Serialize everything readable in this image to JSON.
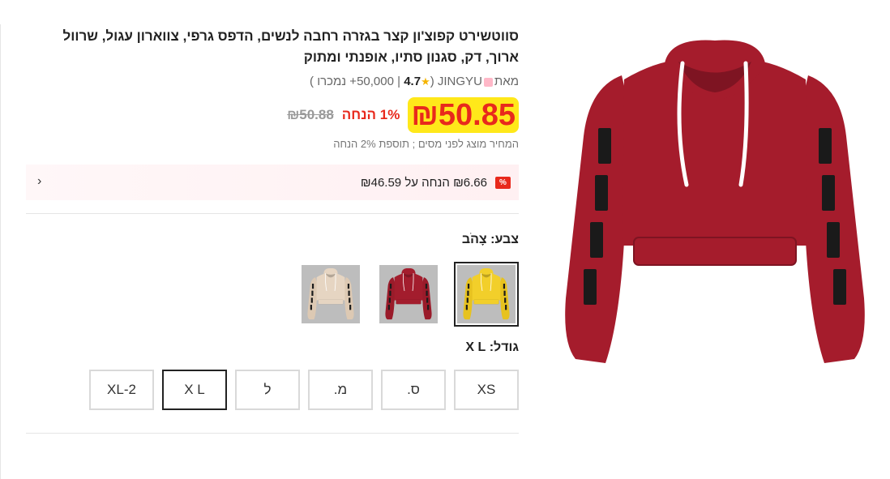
{
  "product": {
    "title": "סווטשירט קפוצ'ון קצר בגזרה רחבה לנשים, הדפס גרפי, צווארון עגול, שרוול ארוך, דק, סגנון סתיו, אופנתי ומתוק",
    "by_label": "מאת",
    "store": "JINGYU",
    "sales_open": "(",
    "sales": "50,000",
    "sales_suffix": "+",
    "rating": "4.7",
    "sold_label": "נמכרו )",
    "separator": "|"
  },
  "pricing": {
    "price": "₪50.85",
    "discount": "1% הנחה",
    "old_price": "₪50.88",
    "tax_note": "המחיר מוצג לפני מסים ; תוספת 2% הנחה"
  },
  "promo": {
    "badge": "%",
    "text": "₪6.66 הנחה על ₪46.59",
    "chevron": "‹"
  },
  "color": {
    "label": "צבע: צָהֹב",
    "swatches": [
      {
        "name": "yellow",
        "color": "#f2cf2a",
        "sleeve_color": "#e7c21f"
      },
      {
        "name": "red",
        "color": "#a31d2d",
        "sleeve_color": "#9a1b2a"
      },
      {
        "name": "beige",
        "color": "#e6d5c2",
        "sleeve_color": "#ddc9b3"
      }
    ],
    "selected_index": 0
  },
  "size": {
    "label": "גודל: X L",
    "options": [
      "XS",
      "ס.",
      "מ.",
      "ל",
      "X L",
      "XL-2"
    ],
    "selected_index": 4
  },
  "colors": {
    "accent": "#e8291c",
    "highlight": "#ffe81a",
    "hoodie": "#a51c2c",
    "hoodie_shadow": "#7e1422"
  },
  "icons": {
    "rating": "star-icon",
    "promo": "discount-badge-icon",
    "promo_arrow": "chevron-left-icon",
    "store": "shopping-bag-icon"
  }
}
